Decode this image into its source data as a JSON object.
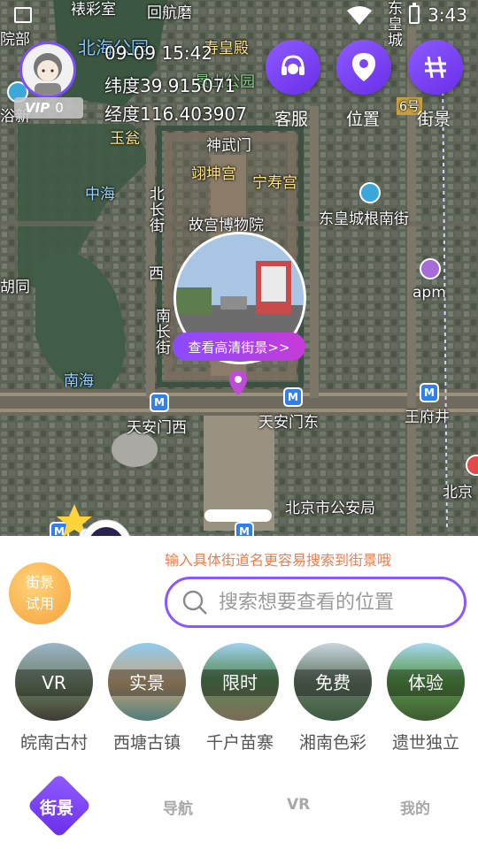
{
  "status_bar": {
    "time": "3:43"
  },
  "profile": {
    "vip_label": "VIP",
    "vip_count": "0"
  },
  "info": {
    "datetime": "09-09 15:42",
    "latitude": "纬度39.915071",
    "longitude": "经度116.403907"
  },
  "actions": [
    {
      "label": "客服",
      "icon": "headset-icon"
    },
    {
      "label": "位置",
      "icon": "location-pin-icon"
    },
    {
      "label": "街景",
      "icon": "street-view-icon"
    }
  ],
  "map_labels": {
    "beihai_park": "北海公园",
    "jingshan_park": "景山公园",
    "shouhuang_hall": "寿皇殿",
    "yushan": "玉瓮",
    "zhonghai": "中海",
    "shenwumen": "神武门",
    "yikun": "翊坤宫",
    "ningshou": "宁寿宫",
    "palace_museum": "故宫博物院",
    "donghuangchenggen": "东皇城根南街",
    "beichang": "北长街",
    "nanchang": "南长街",
    "nanhai": "南海",
    "apm": "apm",
    "tiananmen_west": "天安门西",
    "tiananmen_east": "天安门东",
    "wangfujing": "王府井",
    "police": "北京市公安局",
    "beijing": "北京",
    "hutong": "胡同",
    "top_left": "院部",
    "top_left2": "浴新",
    "top_mid": "回航磨",
    "top_mid2": "裱彩室",
    "top_right": "东皇城",
    "xi": "西",
    "six": "6号"
  },
  "street_view": {
    "button_label": "查看高清街景>>"
  },
  "sheet": {
    "hint": "输入具体街道名更容易搜索到街景哦",
    "trial_line1": "街景",
    "trial_line2": "试用",
    "search_placeholder": "搜索想要查看的位置"
  },
  "categories": [
    {
      "tag": "VR",
      "name": "皖南古村"
    },
    {
      "tag": "实景",
      "name": "西塘古镇"
    },
    {
      "tag": "限时",
      "name": "千户苗寨"
    },
    {
      "tag": "免费",
      "name": "湘南色彩"
    },
    {
      "tag": "体验",
      "name": "遗世独立"
    }
  ],
  "tabs": [
    {
      "label": "街景",
      "active": true
    },
    {
      "label": "导航",
      "active": false
    },
    {
      "label": "VR",
      "active": false
    },
    {
      "label": "我的",
      "active": false
    }
  ],
  "colors": {
    "accent": "#7b45f5",
    "hint": "#f07b4b",
    "trial": "#f6a13a"
  }
}
